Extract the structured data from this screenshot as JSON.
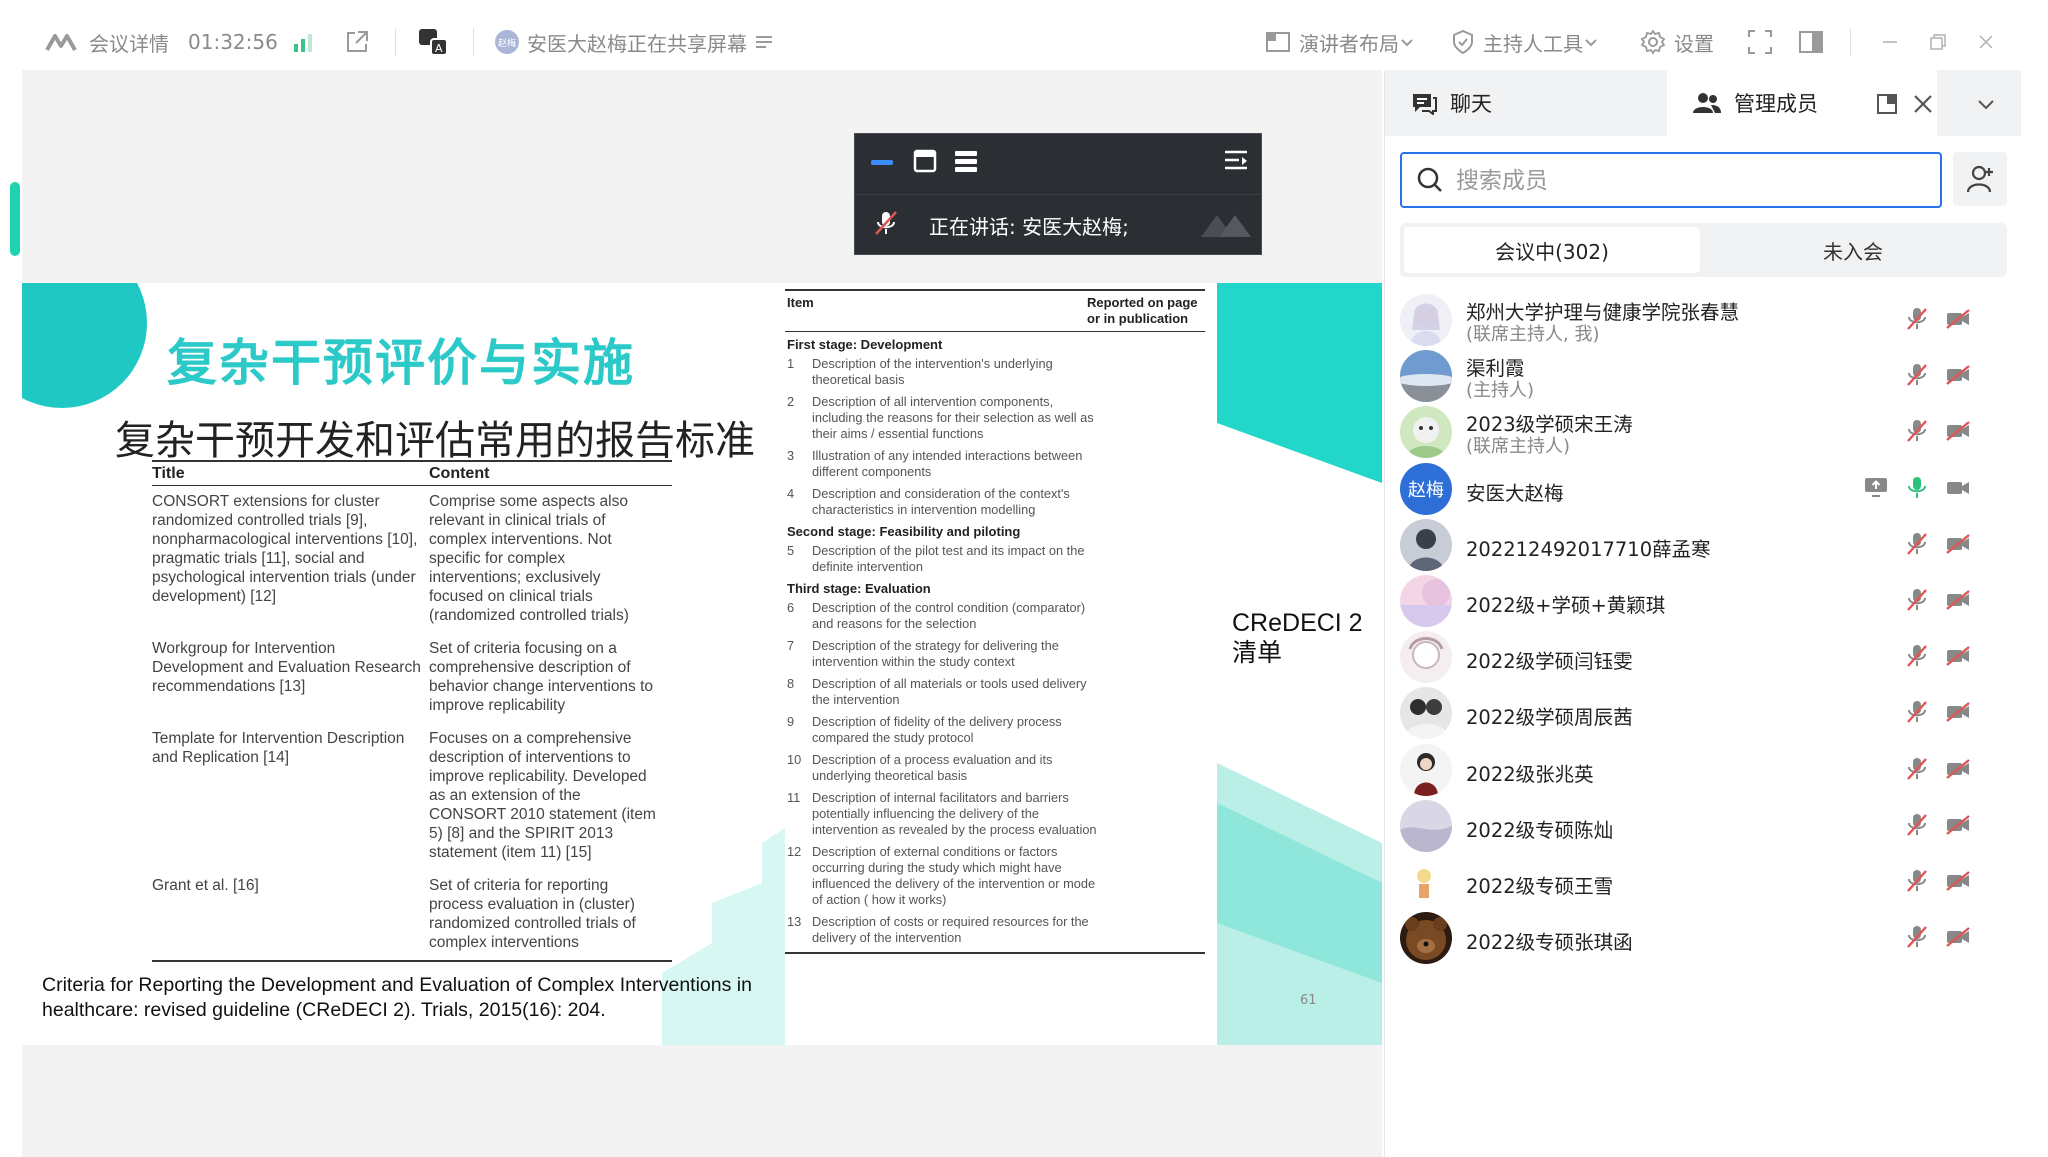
{
  "titlebar": {
    "meeting_details": "会议详情",
    "elapsed": "01:32:56",
    "sharing_avatar": "赵梅",
    "sharing_text": "安医大赵梅正在共享屏幕",
    "layout_label": "演讲者布局",
    "host_tools_label": "主持人工具",
    "settings_label": "设置"
  },
  "speaker_bar": {
    "talking_text": "正在讲话:  安医大赵梅;"
  },
  "slide": {
    "title": "复杂干预评价与实施",
    "subtitle": "复杂干预开发和评估常用的报告标准",
    "left_table": {
      "headers": [
        "Title",
        "Content"
      ],
      "rows": [
        [
          "CONSORT extensions for cluster randomized controlled trials [9], nonpharmacological interventions [10], pragmatic trials [11], social and psychological intervention trials (under development) [12]",
          "Comprise some aspects also relevant in clinical trials of complex interventions. Not specific for complex interventions; exclusively focused on clinical trials (randomized controlled trials)"
        ],
        [
          "Workgroup for Intervention Development and Evaluation Research recommendations [13]",
          "Set of criteria focusing on a comprehensive description of behavior change interventions to improve replicability"
        ],
        [
          "Template for Intervention Description and Replication [14]",
          "Focuses on a comprehensive description of interventions to improve replicability. Developed as an extension of the CONSORT 2010 statement (item 5) [8] and the SPIRIT 2013 statement (item 11) [15]"
        ],
        [
          "Grant et al. [16]",
          "Set of criteria for reporting process evaluation in (cluster) randomized controlled trials of complex interventions"
        ]
      ]
    },
    "citation": "Criteria for Reporting the Development and Evaluation of Complex Interventions in healthcare: revised guideline (CReDECI 2). Trials, 2015(16): 204.",
    "right_table": {
      "header_item": "Item",
      "header_reported": "Reported on page or in publication",
      "stage1": "First stage: Development",
      "items1": [
        [
          "1",
          "Description of the intervention's underlying theoretical basis"
        ],
        [
          "2",
          "Description of all intervention components, including the reasons for their selection as well as their aims / essential functions"
        ],
        [
          "3",
          "Illustration of any intended interactions between different components"
        ],
        [
          "4",
          "Description and consideration of the context's characteristics in intervention modelling"
        ]
      ],
      "stage2": "Second stage: Feasibility and piloting",
      "items2": [
        [
          "5",
          "Description of the pilot test and its impact on the definite intervention"
        ]
      ],
      "stage3": "Third stage: Evaluation",
      "items3": [
        [
          "6",
          "Description of the control condition (comparator) and reasons for the selection"
        ],
        [
          "7",
          "Description of the strategy for delivering the intervention within the study context"
        ],
        [
          "8",
          "Description of all materials or tools used delivery the intervention"
        ],
        [
          "9",
          "Description of fidelity of the delivery process compared the study protocol"
        ],
        [
          "10",
          "Description of a process evaluation and its underlying theoretical basis"
        ],
        [
          "11",
          "Description of internal facilitators and barriers potentially influencing the delivery of the intervention as revealed by the process evaluation"
        ],
        [
          "12",
          "Description of external conditions or factors occurring during the study which might have influenced the delivery of the intervention or mode of action ( how it works)"
        ],
        [
          "13",
          "Description of costs or required resources for the delivery of the intervention"
        ]
      ]
    },
    "credeci_label": "CReDECI 2\n清单",
    "page_number": "61"
  },
  "panel": {
    "tab_chat": "聊天",
    "tab_members": "管理成员",
    "search_placeholder": "搜索成员",
    "subtab_in": "会议中(302)",
    "subtab_out": "未入会",
    "members": [
      {
        "name": "郑州大学护理与健康学院张春慧",
        "role": "(联席主持人, 我)",
        "avatar": "photo-anime"
      },
      {
        "name": "渠利霞",
        "role": "(主持人)",
        "avatar": "photo-landscape"
      },
      {
        "name": "2023级学硕宋王涛",
        "role": "(联席主持人)",
        "avatar": "photo-cartoon"
      },
      {
        "name": "安医大赵梅",
        "role": "",
        "avatar_text": "赵梅",
        "speaking": true
      },
      {
        "name": "202212492017710薛孟寒",
        "role": "",
        "avatar": "photo-person"
      },
      {
        "name": "2022级+学硕+黄颖琪",
        "role": "",
        "avatar": "photo-sky"
      },
      {
        "name": "2022级学硕闫钰雯",
        "role": "",
        "avatar": "photo-drawing"
      },
      {
        "name": "2022级学硕周辰茜",
        "role": "",
        "avatar": "photo-people"
      },
      {
        "name": "2022级张兆英",
        "role": "",
        "avatar": "photo-girl"
      },
      {
        "name": "2022级专硕陈灿",
        "role": "",
        "avatar": "photo-mist"
      },
      {
        "name": "2022级专硕王雪",
        "role": "",
        "avatar": "photo-sticker"
      },
      {
        "name": "2022级专硕张琪函",
        "role": "",
        "avatar": "photo-bear"
      }
    ]
  },
  "colors": {
    "accent": "#2b72e6",
    "teal": "#2cc9c9",
    "muted_red": "#e05555",
    "speaking_green": "#2ec27e"
  }
}
